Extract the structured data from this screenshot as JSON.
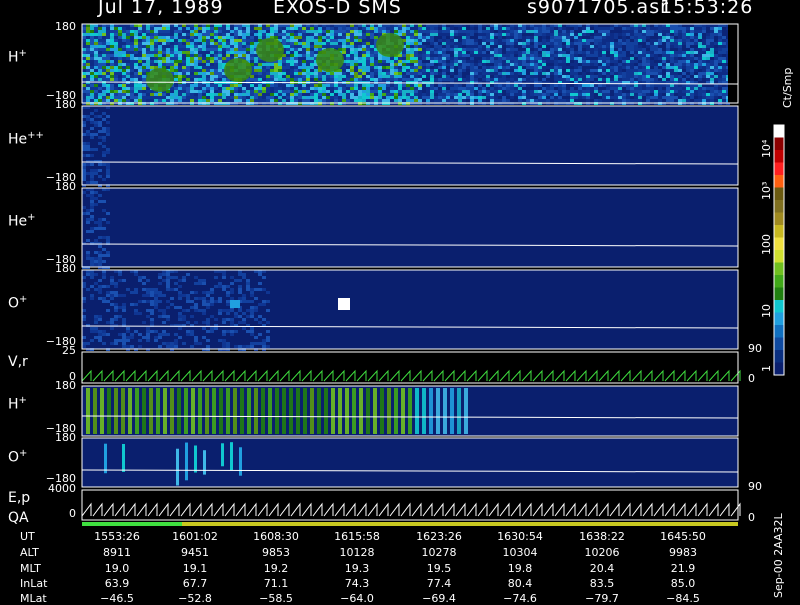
{
  "header": {
    "date": "Jul 17, 1989",
    "instrument": "EXOS-D SMS",
    "file": "s9071705.asr",
    "time": "15:53:26"
  },
  "panels": [
    {
      "id": "h_plus",
      "label": "H",
      "sup": "+",
      "ytop": "180",
      "ybot": "−180"
    },
    {
      "id": "he_pp",
      "label": "He",
      "sup": "++",
      "ytop": "180",
      "ybot": "−180"
    },
    {
      "id": "he_plus",
      "label": "He",
      "sup": "+",
      "ytop": "180",
      "ybot": "−180"
    },
    {
      "id": "o_plus",
      "label": "O",
      "sup": "+",
      "ytop": "180",
      "ybot": "−180"
    },
    {
      "id": "vr",
      "label": "V,r",
      "ytop": "25",
      "ybot": "0",
      "rtop": "90",
      "rbot": "0"
    },
    {
      "id": "h_plus2",
      "label": "H",
      "sup": "+",
      "ytop": "180",
      "ybot": "−180"
    },
    {
      "id": "o_plus2",
      "label": "O",
      "sup": "+",
      "ytop": "180",
      "ybot": "−180",
      "rbot": "90"
    },
    {
      "id": "ep",
      "label": "E,p",
      "label2": "QA",
      "ytop": "4000",
      "ybot": "0",
      "rbot": "0"
    }
  ],
  "colorbar": {
    "unit": "Ct/Smp",
    "ticks": [
      "10⁴",
      "10³",
      "100",
      "10",
      "1"
    ],
    "colors": [
      "#ffffff",
      "#8b0000",
      "#c00000",
      "#ff2020",
      "#ff6010",
      "#6b5a10",
      "#807020",
      "#a08a20",
      "#c8b820",
      "#f0e040",
      "#d0e030",
      "#70c020",
      "#40a818",
      "#208010",
      "#10c8d0",
      "#20a0e0",
      "#1070c0",
      "#0f4aa0",
      "#0a2f80",
      "#0a1f6e"
    ]
  },
  "footer_code": "Sep-00  2AA32L",
  "chart_data": {
    "type": "heatmap",
    "title": "Jul 17, 1989   EXOS-D SMS",
    "xlabel": "UT",
    "x_ticks": [
      "1553:26",
      "1601:02",
      "1608:30",
      "1615:58",
      "1623:26",
      "1630:54",
      "1638:22",
      "1645:50"
    ],
    "rows": [
      {
        "name": "ALT",
        "values": [
          "8911",
          "9451",
          "9853",
          "10128",
          "10278",
          "10304",
          "10206",
          "9983"
        ]
      },
      {
        "name": "MLT",
        "values": [
          "19.0",
          "19.1",
          "19.2",
          "19.3",
          "19.5",
          "19.8",
          "20.4",
          "21.9"
        ]
      },
      {
        "name": "InLat",
        "values": [
          "63.9",
          "67.7",
          "71.1",
          "74.3",
          "77.4",
          "80.4",
          "83.5",
          "85.0"
        ]
      },
      {
        "name": "MLat",
        "values": [
          "−46.5",
          "−52.8",
          "−58.5",
          "−64.0",
          "−69.4",
          "−74.6",
          "−79.7",
          "−84.5"
        ]
      }
    ],
    "y_range_deg": [
      -180,
      180
    ],
    "colorbar_range": [
      1,
      10000
    ],
    "colorbar_scale": "log",
    "colorbar_label": "Ct/Smp"
  }
}
